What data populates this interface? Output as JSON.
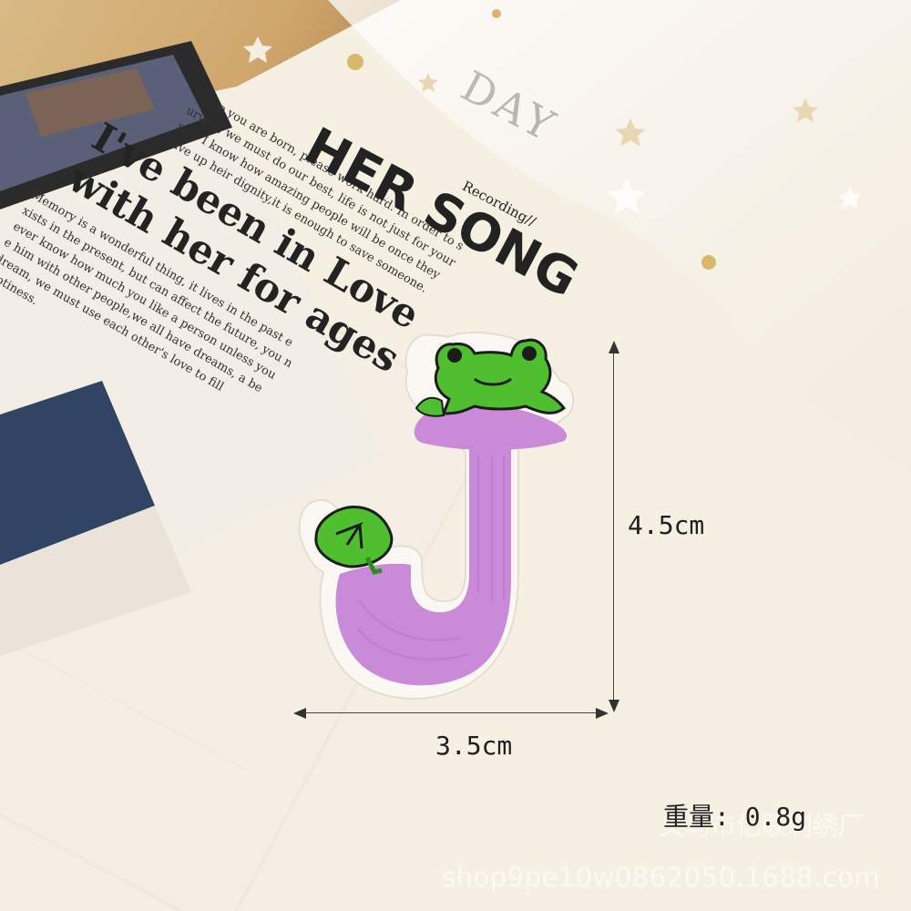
{
  "newspaper": {
    "headline_lines": [
      "I've been in Love",
      "with her for ages"
    ],
    "song_text": "HER SONG",
    "day_text": "DAY",
    "recording_text": "Recording//",
    "body_lines_right": [
      "Since you are born, please work hard. In order to s",
      "urvive, we must do our best, life is not just for your",
      "self. I know how amazing people will be once they",
      "give up heir dignity,it is enough to save someone."
    ],
    "body_lines_left": [
      "Memory is a wonderful thing, it lives in the past e",
      "xists in the present, but can affect the future, you n",
      "ever know how  much you like a person unless you",
      "e him with other people,we all have dreams, a be",
      "dream, we must use each other's love to fill",
      "mptiness."
    ]
  },
  "dimensions": {
    "height_label": "4.5cm",
    "width_label": "3.5cm"
  },
  "weight_label": "重量: 0.8g",
  "watermark": {
    "company": "义乌市亿联刺绣厂",
    "url": "shop9pe10w0862050.1688.com"
  },
  "colors": {
    "patch_pink": "#c88ad8",
    "patch_green": "#4fbf2f",
    "background": "#f6f0e3"
  }
}
